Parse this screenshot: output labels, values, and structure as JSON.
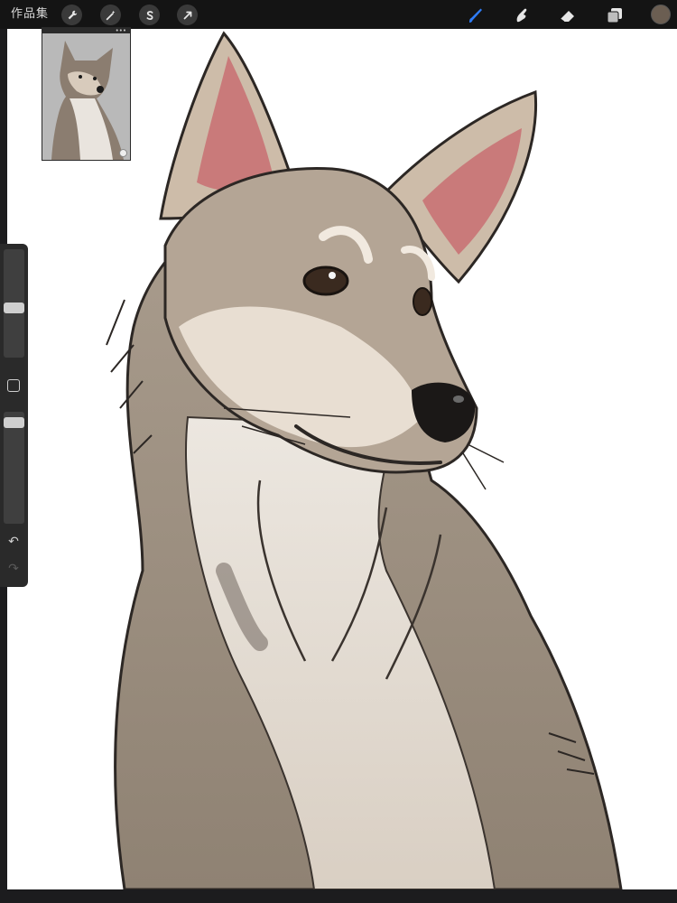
{
  "topbar": {
    "gallery_label": "作品集",
    "tools_left": [
      {
        "name": "actions",
        "icon": "wrench-icon"
      },
      {
        "name": "adjustments",
        "icon": "magic-wand-icon"
      },
      {
        "name": "selection",
        "icon": "selection-s-icon"
      },
      {
        "name": "transform",
        "icon": "arrow-cursor-icon"
      }
    ],
    "tools_right": [
      {
        "name": "paint",
        "icon": "brush-icon",
        "active": true
      },
      {
        "name": "smudge",
        "icon": "smudge-finger-icon",
        "active": false
      },
      {
        "name": "erase",
        "icon": "eraser-icon",
        "active": false
      },
      {
        "name": "layers",
        "icon": "layers-icon",
        "active": false
      }
    ],
    "active_color": "#6b5e52",
    "accent_color": "#2f7cf6"
  },
  "sidebar": {
    "brush_size_level": 0.45,
    "opacity_level": 0.05,
    "modify_icon": "square-icon",
    "undo_icon": "undo-arrow-icon",
    "redo_icon": "redo-arrow-icon"
  },
  "reference": {
    "description_icon": "reference-photo",
    "menu_icon": "more-dots-icon"
  },
  "canvas": {
    "background": "#ffffff",
    "artwork": "dog-illustration"
  }
}
